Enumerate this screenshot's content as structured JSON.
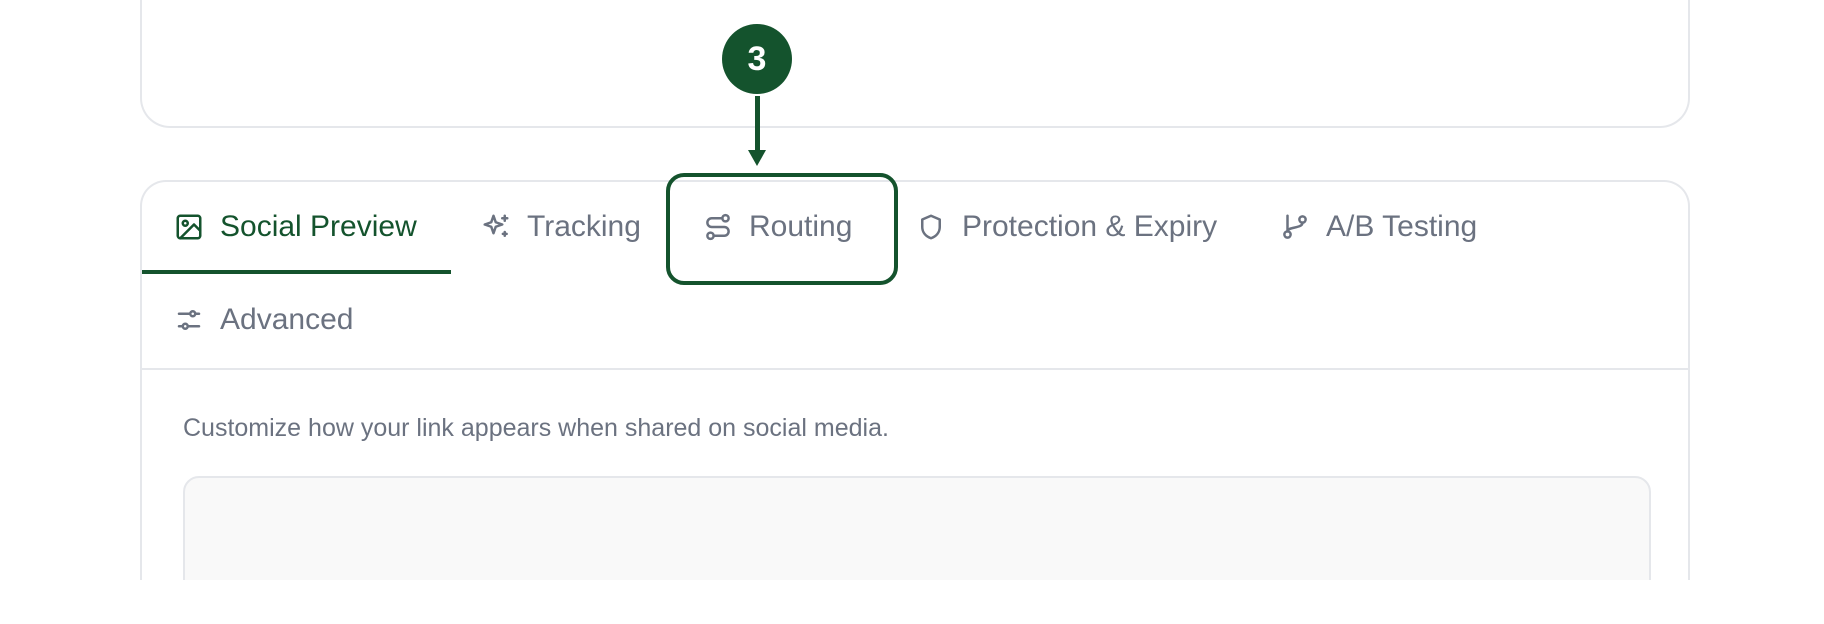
{
  "tabs": [
    {
      "label": "Social Preview",
      "icon": "image-icon",
      "active": true
    },
    {
      "label": "Tracking",
      "icon": "sparkles-icon",
      "active": false
    },
    {
      "label": "Routing",
      "icon": "route-icon",
      "active": false
    },
    {
      "label": "Protection & Expiry",
      "icon": "shield-icon",
      "active": false
    },
    {
      "label": "A/B Testing",
      "icon": "git-branch-icon",
      "active": false
    },
    {
      "label": "Advanced",
      "icon": "sliders-icon",
      "active": false
    }
  ],
  "panel": {
    "description": "Customize how your link appears when shared on social media."
  },
  "annotation": {
    "step": "3",
    "target": "Routing"
  },
  "colors": {
    "accent": "#14532d",
    "muted_text": "#6b7280",
    "border": "#e5e7eb",
    "preview_bg": "#f9f9f9"
  }
}
